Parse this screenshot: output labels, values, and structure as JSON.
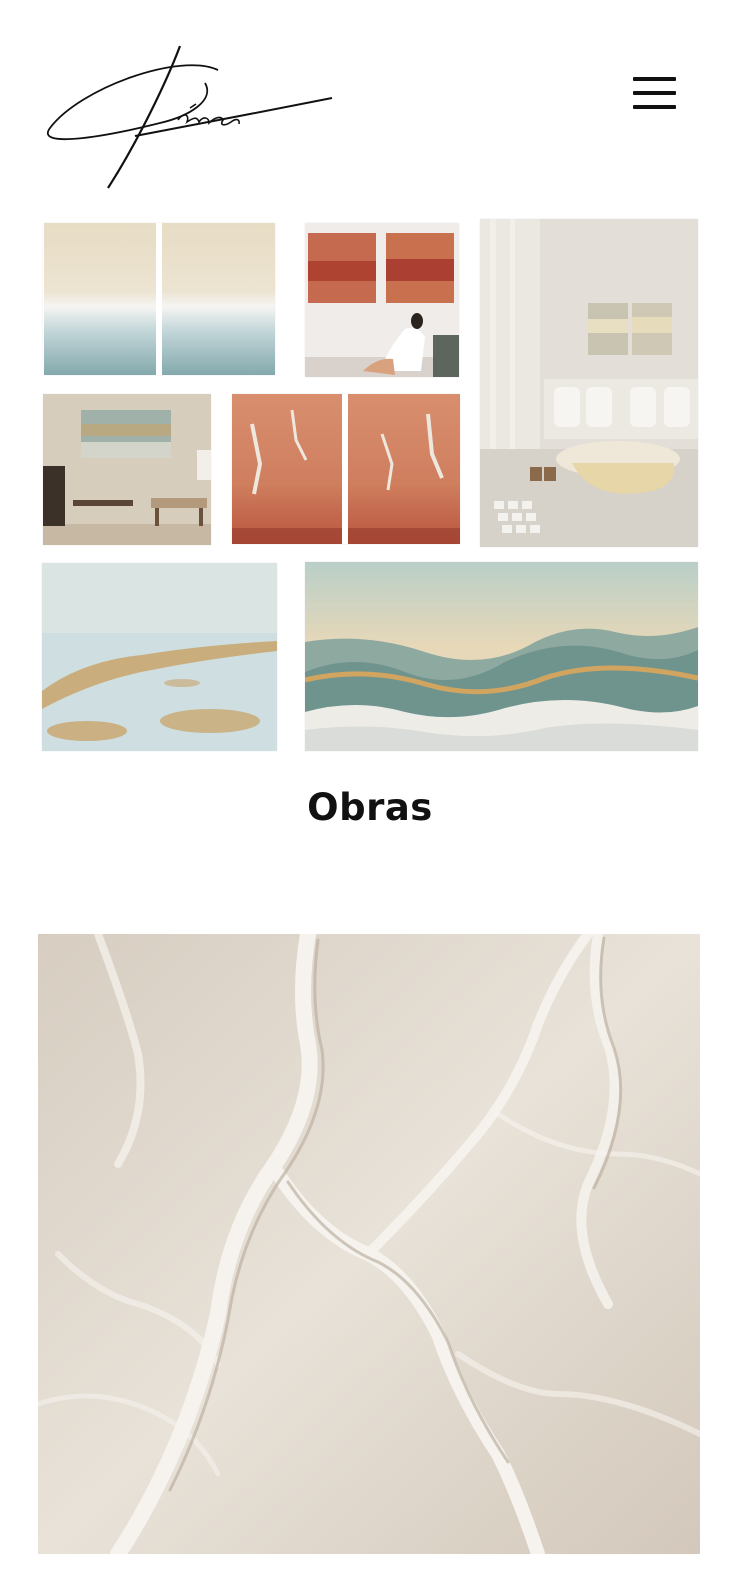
{
  "header": {
    "logo_icon": "signature-logo-icon",
    "menu_icon": "hamburger-menu-icon"
  },
  "gallery": {
    "items": [
      {
        "name": "diptych-sea-foam"
      },
      {
        "name": "red-diptych-with-woman"
      },
      {
        "name": "living-room-interior"
      },
      {
        "name": "beige-room-landscape"
      },
      {
        "name": "terracotta-diptych"
      },
      {
        "name": "pale-blue-gold-abstract"
      },
      {
        "name": "mountain-landscape"
      }
    ]
  },
  "section": {
    "title": "Obras"
  },
  "featured": {
    "name": "white-texture-relief"
  }
}
